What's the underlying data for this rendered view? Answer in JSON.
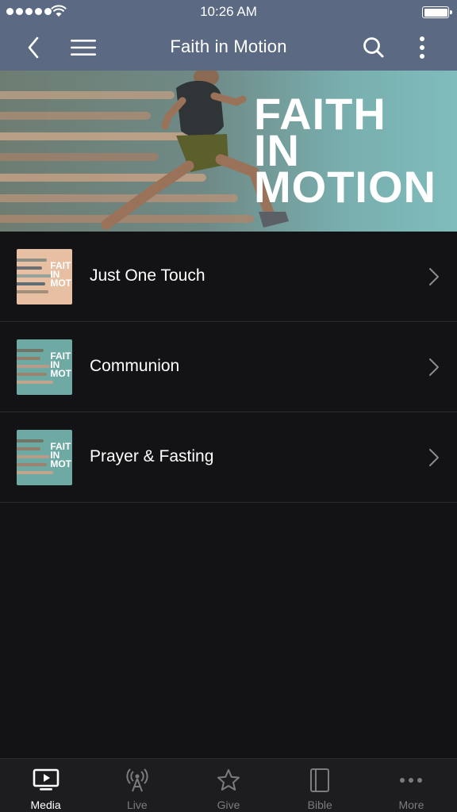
{
  "status_bar": {
    "time": "10:26 AM"
  },
  "nav": {
    "title": "Faith in Motion"
  },
  "hero": {
    "lines": [
      "FAITH",
      "IN",
      "MOTION"
    ]
  },
  "items": [
    {
      "label": "Just One Touch",
      "thumb_bg": "#e7c0a4",
      "thumb_text": "FAIT\nIN\nMOT"
    },
    {
      "label": "Communion",
      "thumb_bg": "#6fa9a4",
      "thumb_text": "FAIT\nIN\nMOT"
    },
    {
      "label": "Prayer & Fasting",
      "thumb_bg": "#6fa9a4",
      "thumb_text": "FAIT\nIN\nMOT"
    }
  ],
  "tabs": [
    {
      "label": "Media",
      "icon": "media-icon",
      "active": true
    },
    {
      "label": "Live",
      "icon": "broadcast-icon",
      "active": false
    },
    {
      "label": "Give",
      "icon": "star-icon",
      "active": false
    },
    {
      "label": "Bible",
      "icon": "book-icon",
      "active": false
    },
    {
      "label": "More",
      "icon": "more-dots-icon",
      "active": false
    }
  ],
  "colors": {
    "nav_bg": "#5b6a82",
    "body_bg": "#131315",
    "tab_bg": "#1d1d20"
  }
}
